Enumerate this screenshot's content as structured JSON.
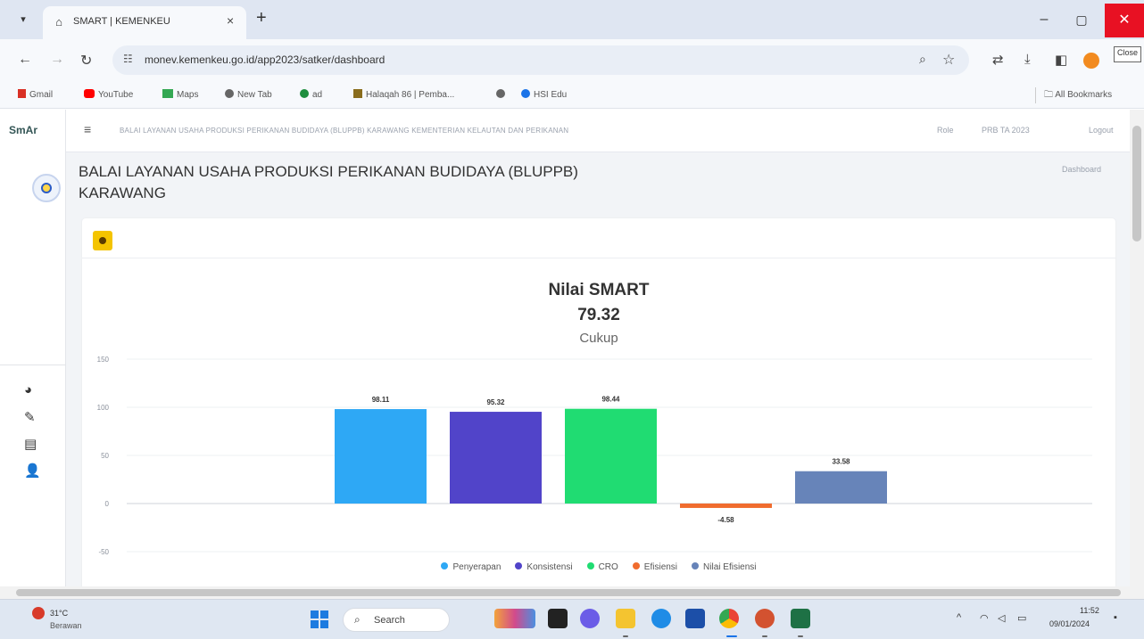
{
  "browser": {
    "tab_title": "SMART | KEMENKEU",
    "url": "monev.kemenkeu.go.id/app2023/satker/dashboard",
    "close_tooltip": "Close"
  },
  "bookmarks": {
    "items": [
      {
        "label": "Gmail",
        "color": "#d93025"
      },
      {
        "label": "YouTube",
        "color": "#ff0000"
      },
      {
        "label": "Maps",
        "color": "#34a853"
      },
      {
        "label": "New Tab",
        "color": "#555555"
      },
      {
        "label": "ad",
        "color": "#1e8e3e"
      },
      {
        "label": "Halaqah 86 | Pemba...",
        "color": "#8a6d1d"
      },
      {
        "label": "",
        "color": "#555555"
      },
      {
        "label": "HSI Edu",
        "color": "#1a73e8"
      }
    ],
    "all_bookmarks": "All Bookmarks"
  },
  "app": {
    "logo": "SmAr",
    "topnav_title": "BALAI LAYANAN USAHA PRODUKSI PERIKANAN BUDIDAYA (BLUPPB) KARAWANG KEMENTERIAN KELAUTAN DAN PERIKANAN",
    "topnav_links": [
      "Role",
      "PRB TA 2023",
      "Logout"
    ],
    "page_title": "BALAI LAYANAN USAHA PRODUKSI PERIKANAN BUDIDAYA (BLUPPB) KARAWANG",
    "breadcrumb": "Dashboard"
  },
  "chart_data": {
    "type": "bar",
    "title": "Nilai SMART",
    "value": "79.32",
    "subtitle": "Cukup",
    "ylim": [
      -50,
      150
    ],
    "yticks": [
      -50,
      0,
      50,
      100,
      150
    ],
    "categories": [
      "Penyerapan",
      "Konsistensi",
      "CRO",
      "Efisiensi",
      "Nilai Efisiensi"
    ],
    "values": [
      98.11,
      95.32,
      98.44,
      -4.58,
      33.58
    ],
    "value_labels": [
      "98.11",
      "95.32",
      "98.44",
      "-4.58",
      "33.58"
    ],
    "colors": [
      "#2ea8f5",
      "#5144c9",
      "#20dc72",
      "#f06c2e",
      "#6784b9"
    ],
    "grid": true,
    "legend": "bottom"
  },
  "taskbar": {
    "weather_temp": "31°C",
    "weather_desc": "Berawan",
    "search": "Search",
    "time": "11:52",
    "date": "09/01/2024"
  }
}
